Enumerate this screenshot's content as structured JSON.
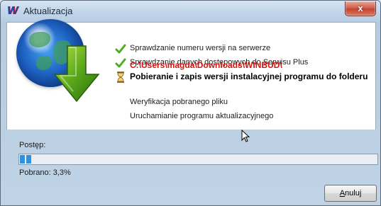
{
  "window": {
    "title": "Aktualizacja",
    "close_symbol": "x"
  },
  "steps": [
    {
      "label": "Sprawdzanie numeru wersji na serwerze",
      "status": "done",
      "icon": "check-icon"
    },
    {
      "label": "Sprawdzanie danych dostępowych do Serwisu Plus",
      "status": "done",
      "icon": "check-icon"
    },
    {
      "label": "Pobieranie i zapis wersji instalacyjnej programu do folderu",
      "status": "active",
      "icon": "hourglass-icon",
      "path": "C:\\Users\\magda\\Downloads\\WINBUD\\"
    },
    {
      "label": "Weryfikacja pobranego pliku",
      "status": "pending"
    },
    {
      "label": "Uruchamianie programu aktualizacyjnego",
      "status": "pending"
    }
  ],
  "progress": {
    "label": "Postęp:",
    "value": 0.033,
    "downloaded_label": "Pobrano: 3,3%"
  },
  "buttons": {
    "cancel_first": "A",
    "cancel_rest": "nuluj"
  },
  "colors": {
    "accent": "#2c93e0",
    "path": "#d4140f",
    "check": "#4caf1f"
  }
}
